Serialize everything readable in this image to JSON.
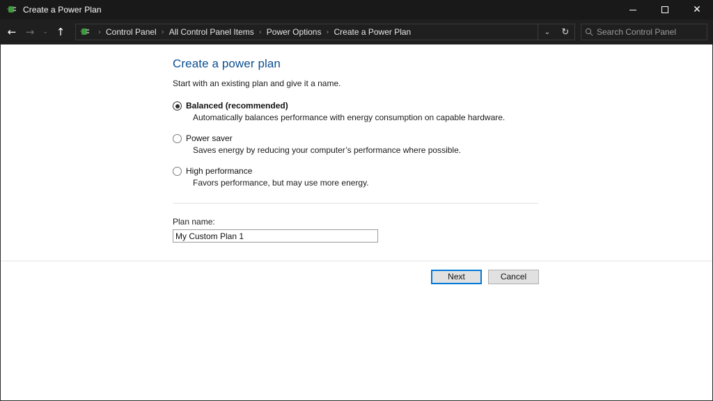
{
  "window": {
    "title": "Create a Power Plan",
    "title_icon": "power-plug-icon",
    "controls": {
      "minimize": "–",
      "maximize": "□",
      "close": "✕"
    }
  },
  "navbar": {
    "back_icon": "←",
    "forward_icon": "→",
    "recent_icon": "⌄",
    "up_icon": "↑",
    "address_icon": "power-plug-icon",
    "breadcrumbs": [
      "Control Panel",
      "All Control Panel Items",
      "Power Options",
      "Create a Power Plan"
    ],
    "crumb_separator": "›",
    "dropdown_icon": "⌄",
    "refresh_icon": "↻",
    "search": {
      "placeholder": "Search Control Panel",
      "icon": "search-icon"
    }
  },
  "main": {
    "title": "Create a power plan",
    "subtitle": "Start with an existing plan and give it a name.",
    "options": [
      {
        "label": "Balanced (recommended)",
        "description": "Automatically balances performance with energy consumption on capable hardware.",
        "selected": true
      },
      {
        "label": "Power saver",
        "description": "Saves energy by reducing your computer’s performance where possible.",
        "selected": false
      },
      {
        "label": "High performance",
        "description": "Favors performance, but may use more energy.",
        "selected": false
      }
    ],
    "plan_name_label": "Plan name:",
    "plan_name_value": "My Custom Plan 1"
  },
  "footer": {
    "next_label": "Next",
    "cancel_label": "Cancel"
  },
  "colors": {
    "titlebar": "#191919",
    "navbar": "#1f1f1f",
    "heading": "#0a4e92",
    "accent": "#0078d7"
  }
}
